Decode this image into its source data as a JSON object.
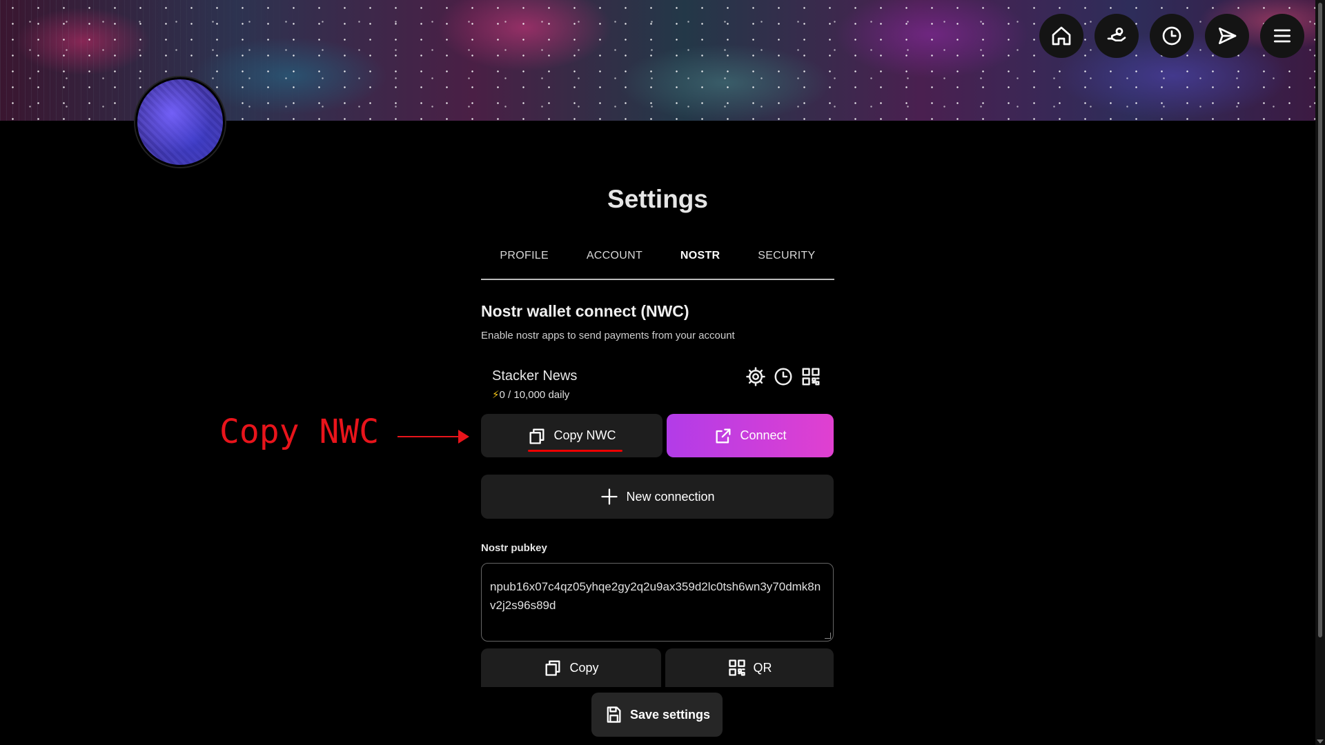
{
  "page": {
    "title": "Settings"
  },
  "nav": {
    "buttons": [
      {
        "name": "home-icon"
      },
      {
        "name": "receive-icon"
      },
      {
        "name": "history-icon"
      },
      {
        "name": "send-icon"
      },
      {
        "name": "menu-icon"
      }
    ]
  },
  "tabs": [
    {
      "label": "PROFILE",
      "active": false
    },
    {
      "label": "ACCOUNT",
      "active": false
    },
    {
      "label": "NOSTR",
      "active": true
    },
    {
      "label": "SECURITY",
      "active": false
    }
  ],
  "nwc": {
    "title": "Nostr wallet connect (NWC)",
    "description": "Enable nostr apps to send payments from your account",
    "connection": {
      "name": "Stacker News",
      "budget": "0 / 10,000 daily",
      "icons": [
        "gear-icon",
        "clock-icon",
        "qr-icon"
      ]
    },
    "copy_label": "Copy NWC",
    "connect_label": "Connect",
    "new_connection_label": "New connection"
  },
  "annotation": {
    "text": "Copy NWC",
    "color": "#e8141b"
  },
  "pubkey": {
    "label": "Nostr pubkey",
    "value": "npub16x07c4qz05yhqe2gy2q2u9ax359d2lc0tsh6wn3y70dmk8nv2j2s96s89d",
    "copy_label": "Copy",
    "qr_label": "QR"
  },
  "save_label": "Save settings",
  "colors": {
    "accent_start": "#b23ce8",
    "accent_end": "#e040d0",
    "annotation": "#e8141b"
  }
}
